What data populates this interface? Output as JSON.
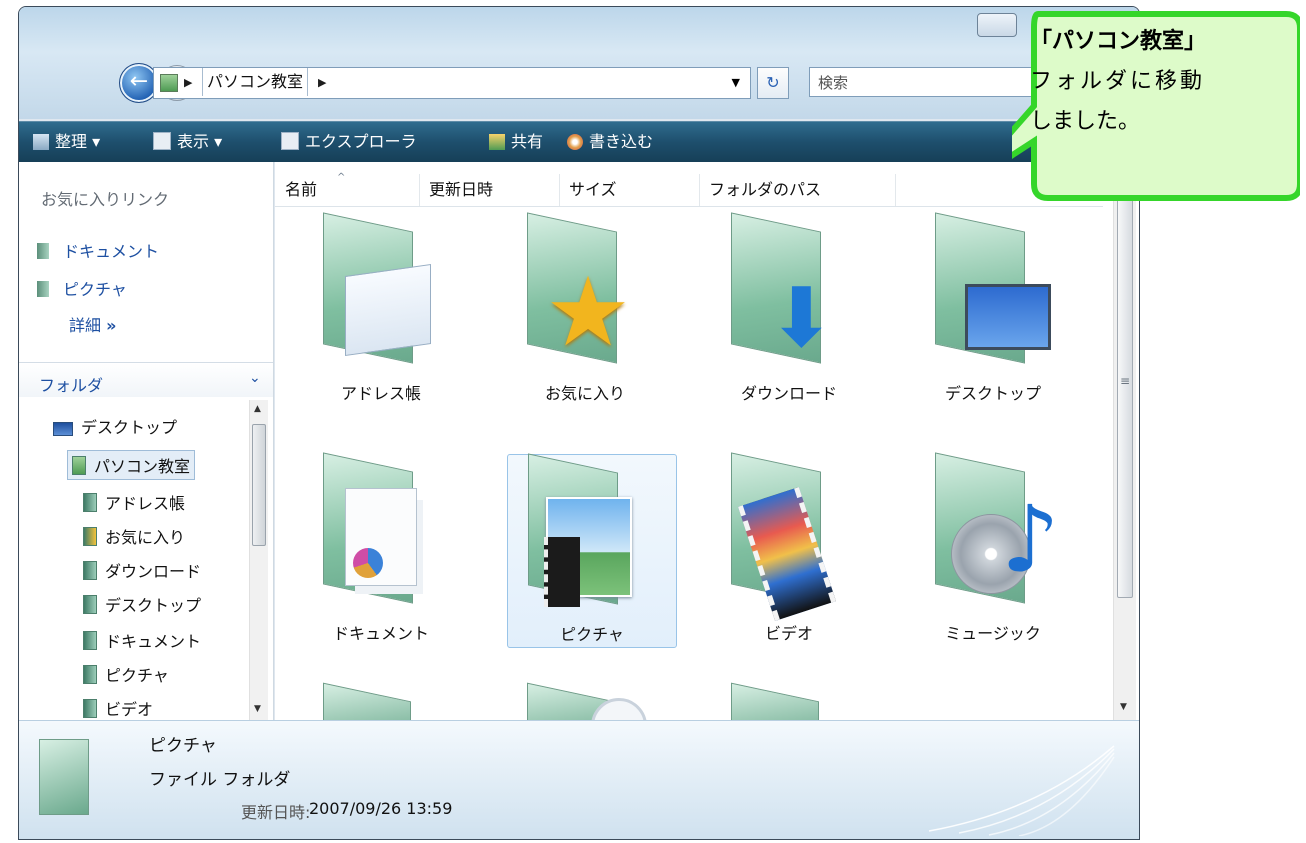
{
  "window": {
    "address_crumb": "パソコン教室",
    "search_placeholder": "検索"
  },
  "toolbar": {
    "organize": "整理",
    "views": "表示",
    "explorer": "エクスプローラ",
    "share": "共有",
    "burn": "書き込む"
  },
  "left_pane": {
    "favorites_title": "お気に入りリンク",
    "favorites": [
      "ドキュメント",
      "ピクチャ"
    ],
    "more": "詳細",
    "folders_title": "フォルダ",
    "tree": [
      "デスクトップ",
      "パソコン教室",
      "アドレス帳",
      "お気に入り",
      "ダウンロード",
      "デスクトップ",
      "ドキュメント",
      "ピクチャ",
      "ビデオ"
    ]
  },
  "columns": [
    "名前",
    "更新日時",
    "サイズ",
    "フォルダのパス"
  ],
  "items": [
    {
      "label": "アドレス帳",
      "icon": "contacts-folder-icon"
    },
    {
      "label": "お気に入り",
      "icon": "favorites-folder-icon"
    },
    {
      "label": "ダウンロード",
      "icon": "downloads-folder-icon"
    },
    {
      "label": "デスクトップ",
      "icon": "desktop-folder-icon"
    },
    {
      "label": "ドキュメント",
      "icon": "documents-folder-icon"
    },
    {
      "label": "ピクチャ",
      "icon": "pictures-folder-icon",
      "selected": true
    },
    {
      "label": "ビデオ",
      "icon": "videos-folder-icon"
    },
    {
      "label": "ミュージック",
      "icon": "music-folder-icon"
    }
  ],
  "status": {
    "name": "ピクチャ",
    "type": "ファイル フォルダ",
    "modified_label": "更新日時:",
    "modified_value": "2007/09/26 13:59"
  },
  "callout": {
    "line1": "「パソコン教室」",
    "line2": "フォルダに移動",
    "line3": "しました。"
  },
  "colors": {
    "toolbar": "#1e4f6d",
    "link": "#1e50a2",
    "callout_fill": "#ddfbc9",
    "callout_border": "#35d62a"
  }
}
